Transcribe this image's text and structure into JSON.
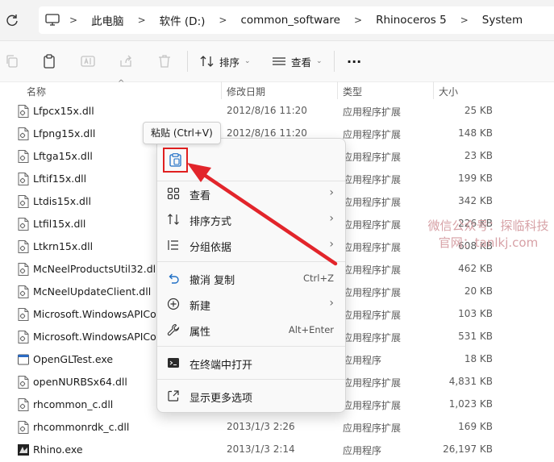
{
  "address_bar": {
    "crumbs": [
      "此电脑",
      "软件 (D:)",
      "common_software",
      "Rhinoceros 5",
      "System"
    ]
  },
  "toolbar": {
    "sort_label": "排序",
    "view_label": "查看",
    "more_label": "···"
  },
  "columns": {
    "name": "名称",
    "date": "修改日期",
    "type": "类型",
    "size": "大小"
  },
  "files": [
    {
      "name": "Lfpcx15x.dll",
      "date": "2012/8/16 11:20",
      "type": "应用程序扩展",
      "size": "25 KB",
      "icon": "dll"
    },
    {
      "name": "Lfpng15x.dll",
      "date": "2012/8/16 11:20",
      "type": "应用程序扩展",
      "size": "148 KB",
      "icon": "dll"
    },
    {
      "name": "Lftga15x.dll",
      "date": "",
      "type": "应用程序扩展",
      "size": "23 KB",
      "icon": "dll"
    },
    {
      "name": "Lftif15x.dll",
      "date": "",
      "type": "应用程序扩展",
      "size": "199 KB",
      "icon": "dll"
    },
    {
      "name": "Ltdis15x.dll",
      "date": "",
      "type": "应用程序扩展",
      "size": "342 KB",
      "icon": "dll"
    },
    {
      "name": "Ltfil15x.dll",
      "date": "",
      "type": "应用程序扩展",
      "size": "226 KB",
      "icon": "dll"
    },
    {
      "name": "Ltkrn15x.dll",
      "date": "",
      "type": "应用程序扩展",
      "size": "608 KB",
      "icon": "dll"
    },
    {
      "name": "McNeelProductsUtil32.dll",
      "date": "",
      "type": "应用程序扩展",
      "size": "462 KB",
      "icon": "dll"
    },
    {
      "name": "McNeelUpdateClient.dll",
      "date": "",
      "type": "应用程序扩展",
      "size": "20 KB",
      "icon": "dll"
    },
    {
      "name": "Microsoft.WindowsAPICod",
      "date": "",
      "type": "应用程序扩展",
      "size": "103 KB",
      "icon": "dll"
    },
    {
      "name": "Microsoft.WindowsAPICod",
      "date": "",
      "type": "应用程序扩展",
      "size": "531 KB",
      "icon": "dll"
    },
    {
      "name": "OpenGLTest.exe",
      "date": "",
      "type": "应用程序",
      "size": "18 KB",
      "icon": "exe"
    },
    {
      "name": "openNURBSx64.dll",
      "date": "",
      "type": "应用程序扩展",
      "size": "4,831 KB",
      "icon": "dll"
    },
    {
      "name": "rhcommon_c.dll",
      "date": "",
      "type": "应用程序扩展",
      "size": "1,023 KB",
      "icon": "dll"
    },
    {
      "name": "rhcommonrdk_c.dll",
      "date": "2013/1/3 2:26",
      "type": "应用程序扩展",
      "size": "169 KB",
      "icon": "dll"
    },
    {
      "name": "Rhino.exe",
      "date": "2013/1/3 2:14",
      "type": "应用程序",
      "size": "26,197 KB",
      "icon": "rhino"
    }
  ],
  "tooltip": "粘贴 (Ctrl+V)",
  "context_menu": {
    "items": [
      {
        "label": "查看",
        "shortcut": "",
        "submenu": true
      },
      {
        "label": "排序方式",
        "shortcut": "",
        "submenu": true
      },
      {
        "label": "分组依据",
        "shortcut": "",
        "submenu": true
      },
      {
        "label": "撤消 复制",
        "shortcut": "Ctrl+Z",
        "submenu": false
      },
      {
        "label": "新建",
        "shortcut": "",
        "submenu": true
      },
      {
        "label": "属性",
        "shortcut": "Alt+Enter",
        "submenu": false
      },
      {
        "label": "在终端中打开",
        "shortcut": "",
        "submenu": false
      },
      {
        "label": "显示更多选项",
        "shortcut": "",
        "submenu": false
      }
    ]
  },
  "watermark": {
    "line1": "微信公众号：探临科技",
    "line2": "官网：tanlkj.com"
  },
  "colors": {
    "highlight_red": "#e02020",
    "arrow_red": "#e2252b",
    "watermark": "#d7a1a6"
  }
}
